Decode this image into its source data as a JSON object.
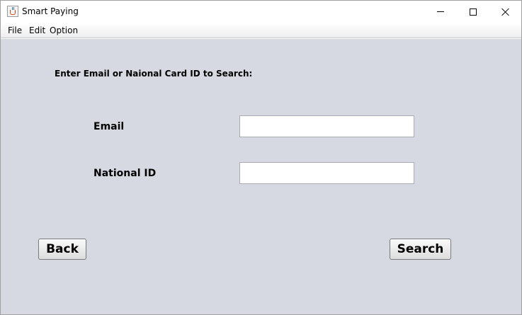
{
  "window": {
    "title": "Smart Paying"
  },
  "menu": {
    "items": [
      {
        "label": "File"
      },
      {
        "label": "Edit"
      },
      {
        "label": "Option"
      }
    ]
  },
  "form": {
    "instruction": "Enter Email or Naional Card ID to Search:",
    "email_label": "Email",
    "email_value": "",
    "national_id_label": "National ID",
    "national_id_value": ""
  },
  "buttons": {
    "back_label": "Back",
    "search_label": "Search"
  },
  "colors": {
    "content_background": "#d6d9e1",
    "titlebar_background": "#ffffff"
  }
}
